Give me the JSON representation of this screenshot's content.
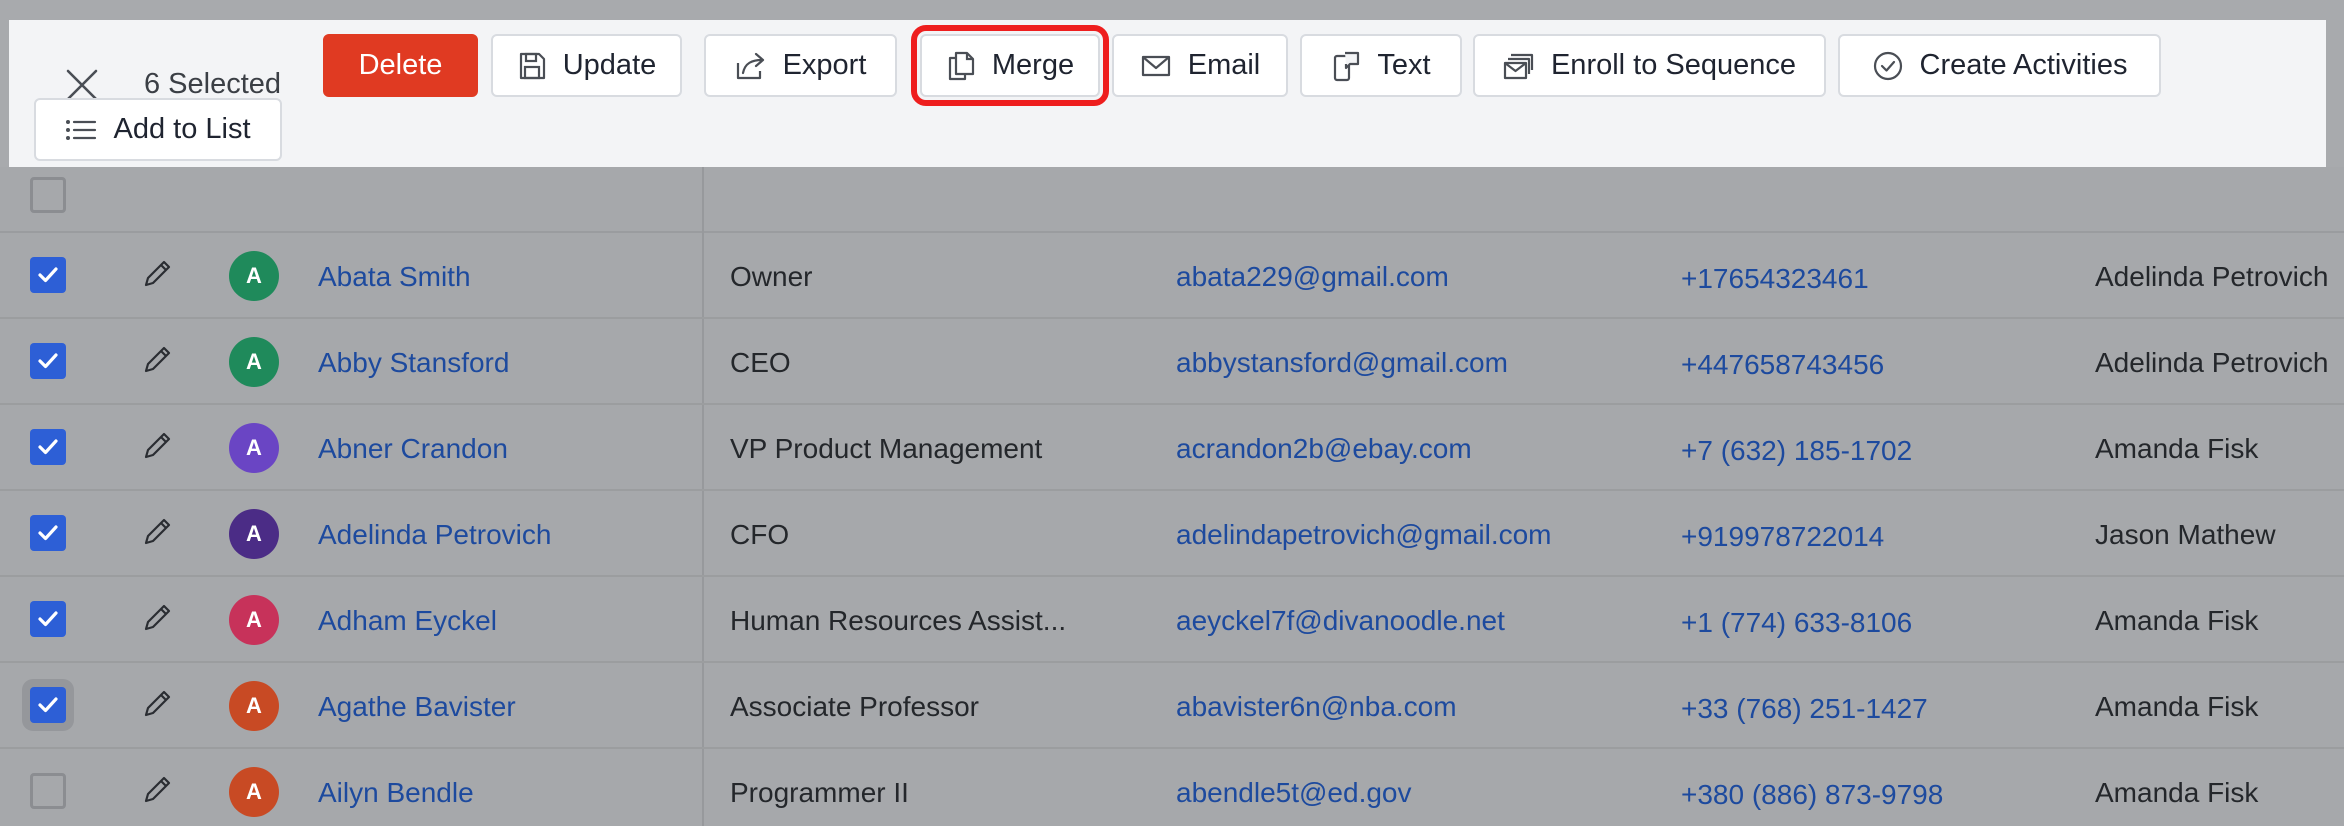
{
  "action_bar": {
    "selected_text": "6 Selected",
    "buttons": {
      "delete": "Delete",
      "update": "Update",
      "export": "Export",
      "merge": "Merge",
      "email": "Email",
      "text": "Text",
      "enroll": "Enroll to Sequence",
      "create_activities": "Create Activities",
      "add_to_list": "Add to List"
    }
  },
  "colors": {
    "delete_bg": "#e03a22",
    "highlight": "#ee1e1e",
    "checkbox": "#2d5fd6",
    "link": "#1d4a9e"
  },
  "rows": [
    {
      "checked": true,
      "avatar": "A",
      "avatar_color": "#1f8a5b",
      "name": "Abata Smith",
      "title": "Owner",
      "email": "abata229@gmail.com",
      "phone": "+17654323461",
      "owner": "Adelinda Petrovich"
    },
    {
      "checked": true,
      "avatar": "A",
      "avatar_color": "#1f8a5b",
      "name": "Abby Stansford",
      "title": "CEO",
      "email": "abbystansford@gmail.com",
      "phone": "+447658743456",
      "owner": "Adelinda Petrovich"
    },
    {
      "checked": true,
      "avatar": "A",
      "avatar_color": "#6a45c4",
      "name": "Abner Crandon",
      "title": "VP Product Management",
      "email": "acrandon2b@ebay.com",
      "phone": "+7 (632) 185-1702",
      "owner": "Amanda Fisk"
    },
    {
      "checked": true,
      "avatar": "A",
      "avatar_color": "#4b2c86",
      "name": "Adelinda Petrovich",
      "title": "CFO",
      "email": "adelindapetrovich@gmail.com",
      "phone": "+919978722014",
      "owner": "Jason Mathew"
    },
    {
      "checked": true,
      "avatar": "A",
      "avatar_color": "#c7325a",
      "name": "Adham Eyckel",
      "title": "Human Resources Assist...",
      "email": "aeyckel7f@divanoodle.net",
      "phone": "+1 (774) 633-8106",
      "owner": "Amanda Fisk"
    },
    {
      "checked": true,
      "avatar": "A",
      "avatar_color": "#c84a24",
      "name": "Agathe Bavister",
      "title": "Associate Professor",
      "email": "abavister6n@nba.com",
      "phone": "+33 (768) 251-1427",
      "owner": "Amanda Fisk"
    },
    {
      "checked": false,
      "avatar": "A",
      "avatar_color": "#c84a24",
      "name": "Ailyn Bendle",
      "title": "Programmer II",
      "email": "abendle5t@ed.gov",
      "phone": "+380 (886) 873-9798",
      "owner": "Amanda Fisk"
    }
  ]
}
